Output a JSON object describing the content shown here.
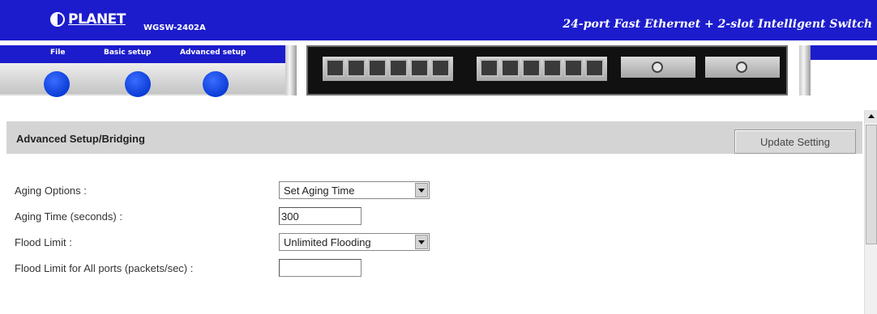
{
  "header": {
    "brand": "PLANET",
    "model": "WGSW-2402A",
    "product_title": "24-port Fast Ethernet + 2-slot Intelligent Switch"
  },
  "nav": {
    "items": [
      {
        "label": "File"
      },
      {
        "label": "Basic setup"
      },
      {
        "label": "Advanced setup"
      }
    ]
  },
  "section": {
    "title": "Advanced Setup/Bridging",
    "update_button": "Update Setting"
  },
  "form": {
    "aging_options": {
      "label": "Aging Options :",
      "value": "Set Aging Time"
    },
    "aging_time": {
      "label": "Aging Time (seconds) :",
      "value": "300"
    },
    "flood_limit": {
      "label": "Flood Limit :",
      "value": "Unlimited Flooding"
    },
    "flood_limit_all": {
      "label": "Flood Limit for All ports (packets/sec) :",
      "value": ""
    }
  },
  "colors": {
    "header_bg": "#1c1ccc",
    "section_bar": "#d4d4d4"
  }
}
